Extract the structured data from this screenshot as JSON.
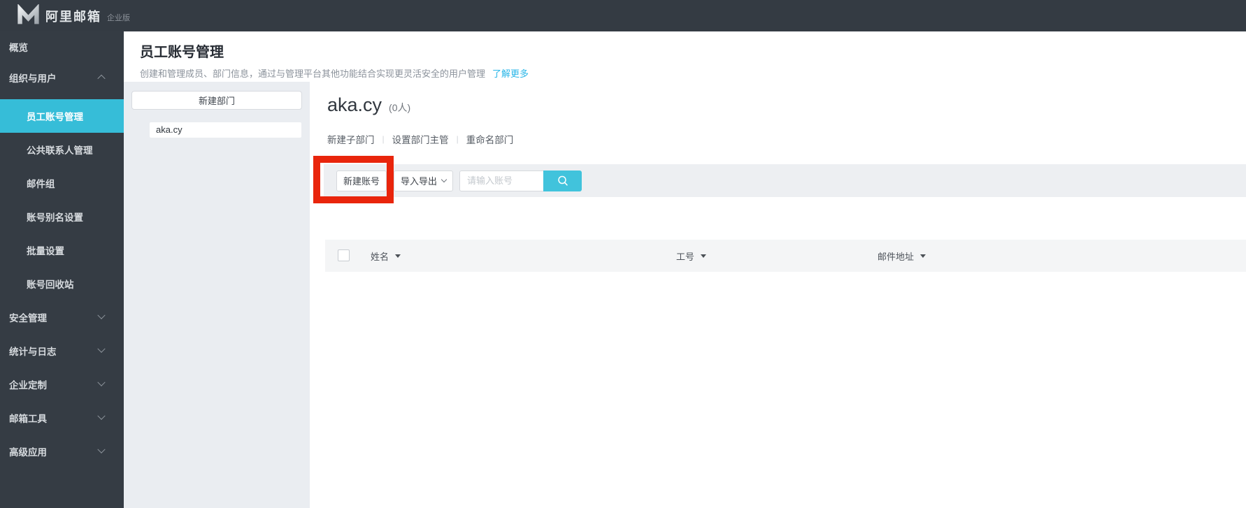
{
  "topbar": {
    "brand": "阿里邮箱",
    "edition": "企业版"
  },
  "sidebar": {
    "items": [
      {
        "label": "概览"
      },
      {
        "label": "组织与用户"
      },
      {
        "label": "员工账号管理"
      },
      {
        "label": "公共联系人管理"
      },
      {
        "label": "邮件组"
      },
      {
        "label": "账号别名设置"
      },
      {
        "label": "批量设置"
      },
      {
        "label": "账号回收站"
      },
      {
        "label": "安全管理"
      },
      {
        "label": "统计与日志"
      },
      {
        "label": "企业定制"
      },
      {
        "label": "邮箱工具"
      },
      {
        "label": "高级应用"
      }
    ]
  },
  "page": {
    "title": "员工账号管理",
    "description": "创建和管理成员、部门信息，通过与管理平台其他功能结合实现更灵活安全的用户管理",
    "learn_more": "了解更多"
  },
  "dept_panel": {
    "new_dept_button": "新建部门",
    "departments": [
      {
        "name": "aka.cy",
        "selected": true
      }
    ]
  },
  "dept_detail": {
    "name": "aka.cy",
    "member_count": "(0人)",
    "actions": [
      "新建子部门",
      "设置部门主管",
      "重命名部门"
    ]
  },
  "toolbar": {
    "new_account": "新建账号",
    "import_export": "导入导出",
    "search_placeholder": "请输入账号"
  },
  "table": {
    "columns": [
      "姓名",
      "工号",
      "邮件地址"
    ]
  },
  "colors": {
    "topbar_bg": "#343b43",
    "sidebar_bg": "#353c44",
    "active_item": "#36bdd8",
    "link": "#29b6e8",
    "search_button": "#41c3dc",
    "highlight_red": "#e9250c",
    "panel_bg": "#eaedf1",
    "toolbar_bg": "#edeff2",
    "table_header_bg": "#f4f5f6"
  }
}
